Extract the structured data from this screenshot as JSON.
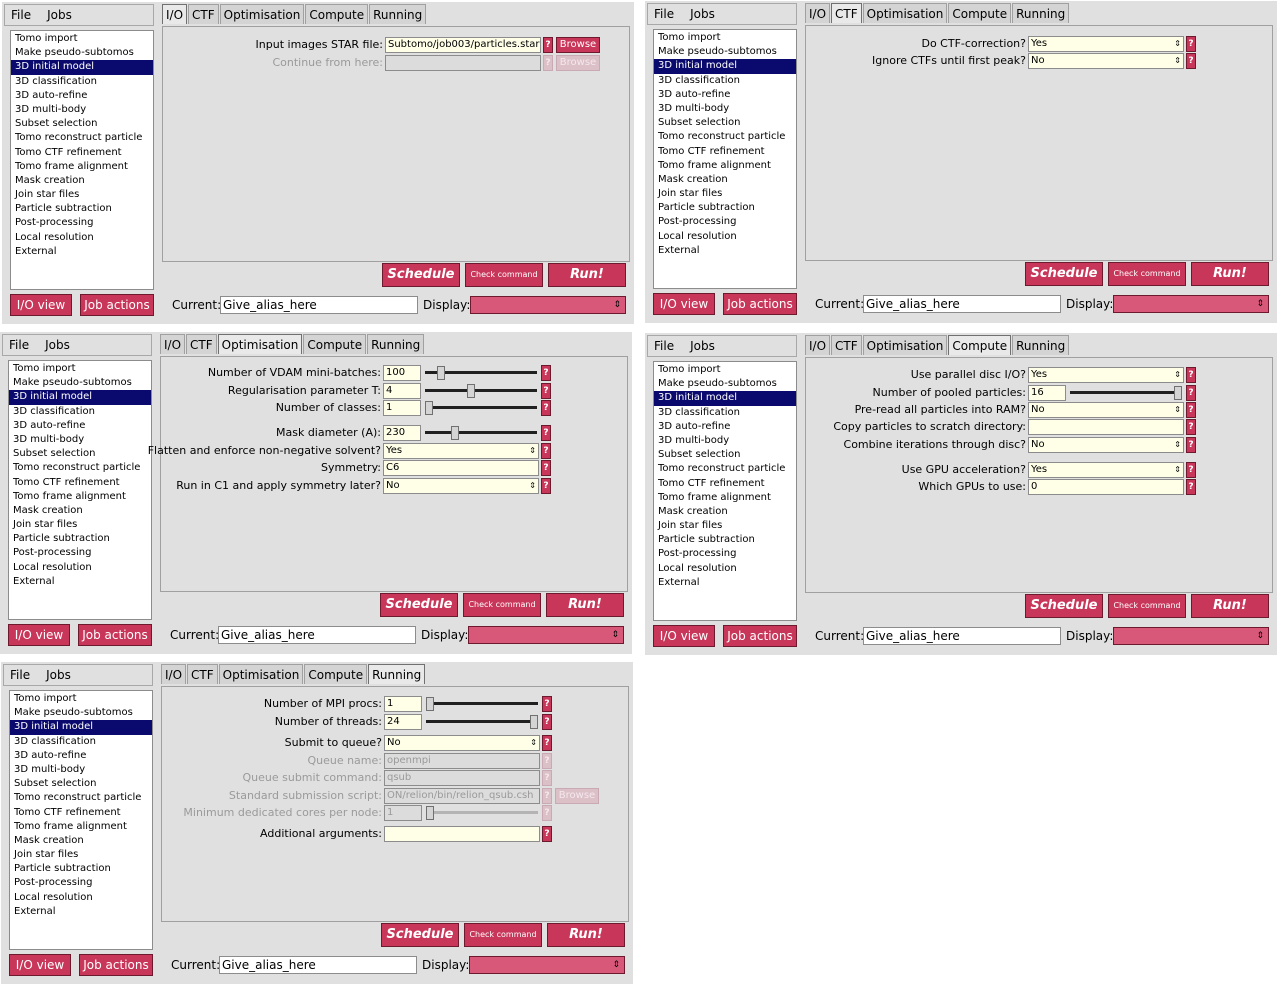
{
  "common": {
    "menu": [
      "File",
      "Jobs"
    ],
    "jobs": [
      "Tomo import",
      "Make pseudo-subtomos",
      "3D initial model",
      "3D classification",
      "3D auto-refine",
      "3D multi-body",
      "Subset selection",
      "Tomo reconstruct particle",
      "Tomo CTF refinement",
      "Tomo frame alignment",
      "Mask creation",
      "Join star files",
      "Particle subtraction",
      "Post-processing",
      "Local resolution",
      "External"
    ],
    "selected_job": "3D initial model",
    "tabs": [
      "I/O",
      "CTF",
      "Optimisation",
      "Compute",
      "Running"
    ],
    "io_view_label": "I/O view",
    "job_actions_label": "Job actions",
    "schedule_label": "Schedule",
    "check_command_label": "Check command",
    "run_label": "Run!",
    "current_label": "Current:",
    "current_alias": "Give_alias_here",
    "display_label": "Display:",
    "help_symbol": "?",
    "browse_label": "Browse",
    "dropdown_arrow": "⇕",
    "colors": {
      "accent": "#c8375a",
      "selection": "#0a0a6e",
      "input_bg": "#ffffe8"
    }
  },
  "panels": {
    "io": {
      "active_tab": "I/O",
      "fields": [
        {
          "label": "Input images STAR file:",
          "value": "Subtomo/job003/particles.star",
          "browse": true
        },
        {
          "label": "Continue from here:",
          "value": "",
          "browse": true,
          "disabled": true
        }
      ]
    },
    "ctf": {
      "active_tab": "CTF",
      "fields": [
        {
          "label": "Do CTF-correction?",
          "value": "Yes",
          "dropdown": true
        },
        {
          "label": "Ignore CTFs until first peak?",
          "value": "No",
          "dropdown": true
        }
      ]
    },
    "optimisation": {
      "active_tab": "Optimisation",
      "fields": [
        {
          "label": "Number of VDAM mini-batches:",
          "value": "100",
          "slider": 0.12
        },
        {
          "label": "Regularisation parameter T:",
          "value": "4",
          "slider": 0.4
        },
        {
          "label": "Number of classes:",
          "value": "1",
          "slider": 0.0
        },
        {
          "label": "Mask diameter (A):",
          "value": "230",
          "slider": 0.25
        },
        {
          "label": "Flatten and enforce non-negative solvent?",
          "value": "Yes",
          "dropdown": true
        },
        {
          "label": "Symmetry:",
          "value": "C6"
        },
        {
          "label": "Run in C1 and apply symmetry later?",
          "value": "No",
          "dropdown": true
        }
      ]
    },
    "compute": {
      "active_tab": "Compute",
      "fields": [
        {
          "label": "Use parallel disc I/O?",
          "value": "Yes",
          "dropdown": true
        },
        {
          "label": "Number of pooled particles:",
          "value": "16",
          "slider": 1.0
        },
        {
          "label": "Pre-read all particles into RAM?",
          "value": "No",
          "dropdown": true
        },
        {
          "label": "Copy particles to scratch directory:",
          "value": ""
        },
        {
          "label": "Combine iterations through disc?",
          "value": "No",
          "dropdown": true
        },
        {
          "label": "Use GPU acceleration?",
          "value": "Yes",
          "dropdown": true
        },
        {
          "label": "Which GPUs to use:",
          "value": "0"
        }
      ]
    },
    "running": {
      "active_tab": "Running",
      "fields": [
        {
          "label": "Number of MPI procs:",
          "value": "1",
          "slider": 0.0
        },
        {
          "label": "Number of threads:",
          "value": "24",
          "slider": 1.0
        },
        {
          "label": "Submit to queue?",
          "value": "No",
          "dropdown": true
        },
        {
          "label": "Queue name:",
          "value": "openmpi",
          "disabled": true
        },
        {
          "label": "Queue submit command:",
          "value": "qsub",
          "disabled": true
        },
        {
          "label": "Standard submission script:",
          "value": "ON/relion/bin/relion_qsub.csh",
          "browse": true,
          "disabled": true
        },
        {
          "label": "Minimum dedicated cores per node:",
          "value": "1",
          "slider": 0.0,
          "disabled": true
        },
        {
          "label": "Additional arguments:",
          "value": ""
        }
      ]
    }
  }
}
